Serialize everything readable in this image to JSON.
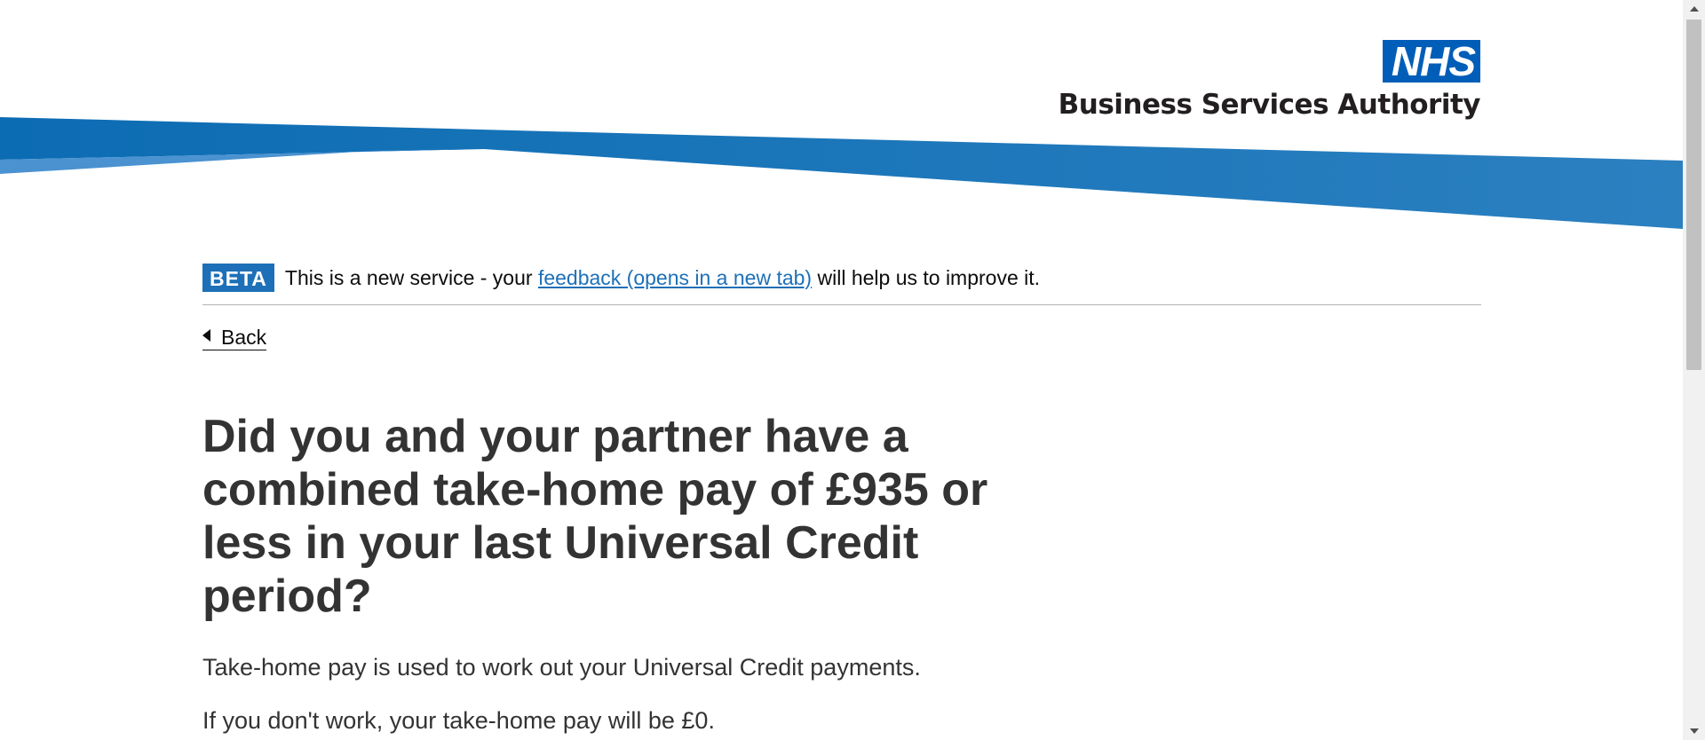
{
  "header": {
    "logo_mark": "NHS",
    "org_name": "Business Services Authority"
  },
  "phase_banner": {
    "tag": "BETA",
    "text_before": "This is a new service - your ",
    "link_text": "feedback (opens in a new tab)",
    "text_after": " will help us to improve it."
  },
  "back_link": {
    "label": "Back"
  },
  "main": {
    "question": "Did you and your partner have a combined take-home pay of £935 or less in your last Universal Credit period?",
    "hint": "Take-home pay is used to work out your Universal Credit payments.",
    "hint2": "If you don't work, your take-home pay will be £0."
  },
  "colors": {
    "nhs_blue": "#005eb8",
    "link_blue": "#1d70b8",
    "banner_dark": "#0f6fb5",
    "banner_light": "#4a92d0"
  }
}
